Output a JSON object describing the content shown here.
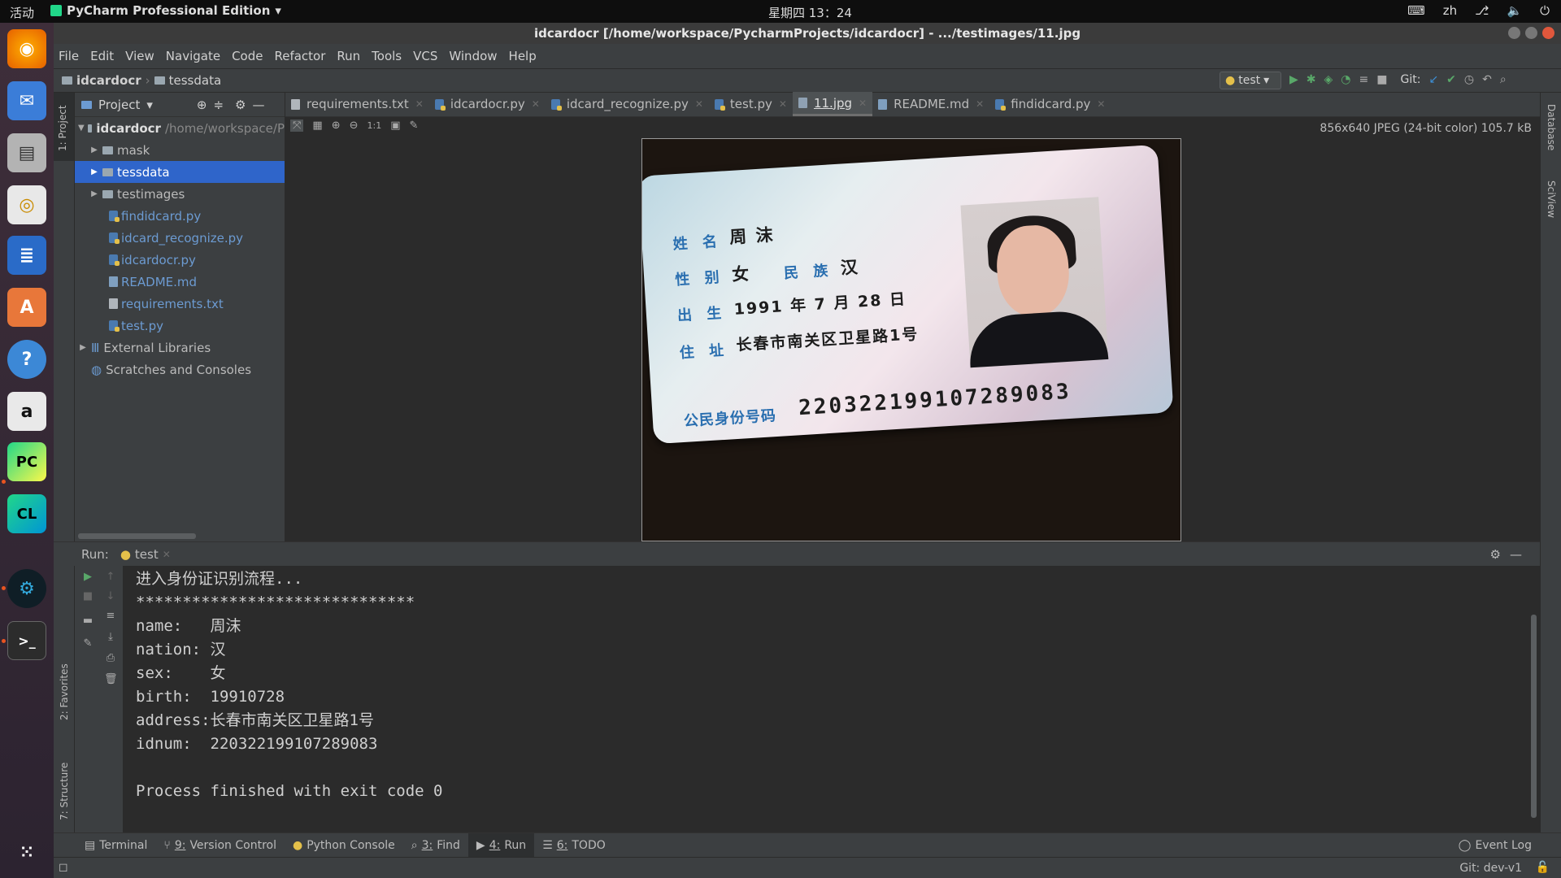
{
  "topbar": {
    "activities": "活动",
    "app_name": "PyCharm Professional Edition",
    "clock": "星期四 13：24",
    "lang": "zh"
  },
  "window": {
    "title": "idcardocr [/home/workspace/PycharmProjects/idcardocr] - .../testimages/11.jpg"
  },
  "menu": [
    "File",
    "Edit",
    "View",
    "Navigate",
    "Code",
    "Refactor",
    "Run",
    "Tools",
    "VCS",
    "Window",
    "Help"
  ],
  "breadcrumb": {
    "project": "idcardocr",
    "folder": "tessdata"
  },
  "toolbar": {
    "run_config": "test",
    "git_label": "Git:"
  },
  "project_panel": {
    "title": "Project",
    "root": "idcardocr",
    "root_path": "/home/workspace/P",
    "items": [
      {
        "name": "mask",
        "type": "folder"
      },
      {
        "name": "tessdata",
        "type": "folder"
      },
      {
        "name": "testimages",
        "type": "folder"
      },
      {
        "name": "findidcard.py",
        "type": "py"
      },
      {
        "name": "idcard_recognize.py",
        "type": "py"
      },
      {
        "name": "idcardocr.py",
        "type": "py"
      },
      {
        "name": "README.md",
        "type": "md"
      },
      {
        "name": "requirements.txt",
        "type": "txt"
      },
      {
        "name": "test.py",
        "type": "py"
      }
    ],
    "external": "External Libraries",
    "scratches": "Scratches and Consoles"
  },
  "tabs": [
    "requirements.txt",
    "idcardocr.py",
    "idcard_recognize.py",
    "test.py",
    "11.jpg",
    "README.md",
    "findidcard.py"
  ],
  "image_viewer": {
    "info": "856x640 JPEG (24-bit color) 105.7 kB",
    "zoom_11": "1:1"
  },
  "idcard": {
    "name_label": "姓 名",
    "name": "周 沫",
    "sex_label": "性 别",
    "sex": "女",
    "nation_label": "民 族",
    "nation": "汉",
    "birth_label": "出 生",
    "birth": "1991 年 7 月 28 日",
    "address_label": "住 址",
    "address": "长春市南关区卫星路1号",
    "id_label": "公民身份号码",
    "id": "220322199107289083"
  },
  "run": {
    "label": "Run:",
    "config": "test",
    "console": [
      "进入身份证识别流程...",
      "******************************",
      "name:   周沫",
      "nation: 汉",
      "sex:    女",
      "birth:  19910728",
      "address:长春市南关区卫星路1号",
      "idnum:  220322199107289083",
      "",
      "Process finished with exit code 0"
    ]
  },
  "left_strip": {
    "project": "1: Project",
    "favorites": "2: Favorites",
    "structure": "7: Structure"
  },
  "right_strip": {
    "database": "Database",
    "sciview": "SciView"
  },
  "bottom_tools": [
    {
      "label": "Terminal",
      "prefix": ""
    },
    {
      "label": "Version Control",
      "prefix": "9:"
    },
    {
      "label": "Python Console",
      "prefix": ""
    },
    {
      "label": "Find",
      "prefix": "3:"
    },
    {
      "label": "Run",
      "prefix": "4:"
    },
    {
      "label": "TODO",
      "prefix": "6:"
    }
  ],
  "event_log": "Event Log",
  "status": {
    "git_branch": "Git: dev-v1"
  }
}
